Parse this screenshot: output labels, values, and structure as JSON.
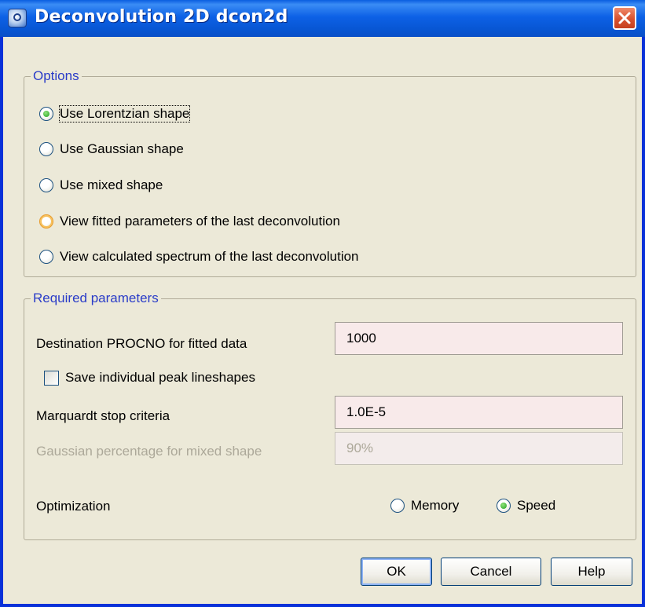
{
  "window": {
    "title": "Deconvolution 2D dcon2d",
    "app_icon": "bruker-topspin-icon",
    "close_icon": "close-icon"
  },
  "options": {
    "legend": "Options",
    "items": [
      {
        "label": "Use Lorentzian shape",
        "checked": true
      },
      {
        "label": "Use Gaussian shape",
        "checked": false
      },
      {
        "label": "Use mixed shape",
        "checked": false
      },
      {
        "label": "View fitted parameters of the last deconvolution",
        "checked": false
      },
      {
        "label": "View calculated spectrum of the last deconvolution",
        "checked": false
      }
    ]
  },
  "required": {
    "legend": "Required parameters",
    "destination_label": "Destination PROCNO for fitted data",
    "destination_value": "1000",
    "save_peaks_label": "Save individual peak lineshapes",
    "save_peaks_checked": false,
    "marquardt_label": "Marquardt stop criteria",
    "marquardt_value": "1.0E-5",
    "gaussian_label": "Gaussian percentage for mixed shape",
    "gaussian_value": "90%",
    "optimization_label": "Optimization",
    "memory_label": "Memory",
    "memory_checked": false,
    "speed_label": "Speed",
    "speed_checked": true
  },
  "buttons": {
    "ok": "OK",
    "cancel": "Cancel",
    "help": "Help"
  }
}
